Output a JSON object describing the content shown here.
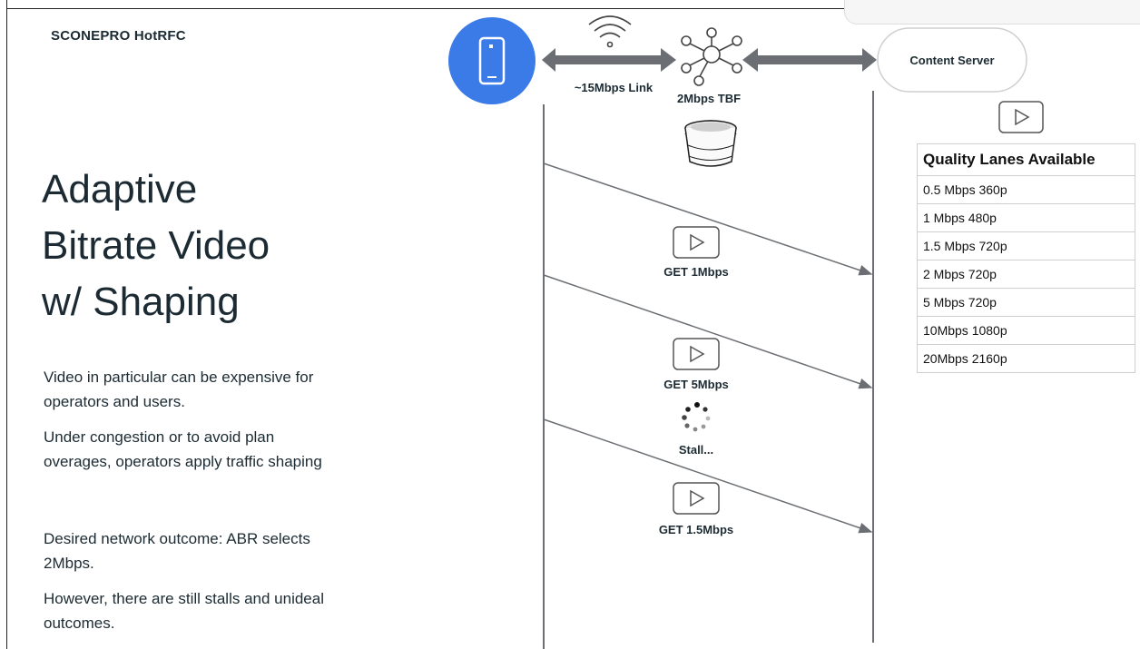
{
  "brand": "SCONEPRO HotRFC",
  "slide": {
    "title_lines": [
      "Adaptive",
      "Bitrate Video",
      "w/ Shaping"
    ],
    "paragraphs": [
      "Video in particular can be expensive for operators and users.",
      "Under congestion or to avoid plan overages, operators apply traffic shaping",
      "Desired network outcome: ABR selects 2Mbps.",
      "However, there are still stalls and unideal outcomes."
    ]
  },
  "diagram": {
    "link_label": "~15Mbps Link",
    "tbf_label": "2Mbps TBF",
    "server_label": "Content Server",
    "requests": [
      {
        "label": "GET 1Mbps"
      },
      {
        "label": "GET 5Mbps"
      },
      {
        "label": "GET 1.5Mbps"
      }
    ],
    "stall_label": "Stall...",
    "colors": {
      "phone": "#3b7be8",
      "arrow": "#6b6f74",
      "line": "#6b6f74"
    },
    "icons": [
      "phone-icon",
      "wifi-icon",
      "hub-icon",
      "bucket-icon",
      "play-icon",
      "spinner-icon"
    ]
  },
  "quality_table": {
    "header": "Quality Lanes Available",
    "rows": [
      "0.5 Mbps 360p",
      "1 Mbps 480p",
      "1.5 Mbps 720p",
      "2 Mbps 720p",
      "5 Mbps 720p",
      "10Mbps 1080p",
      "20Mbps 2160p"
    ]
  }
}
